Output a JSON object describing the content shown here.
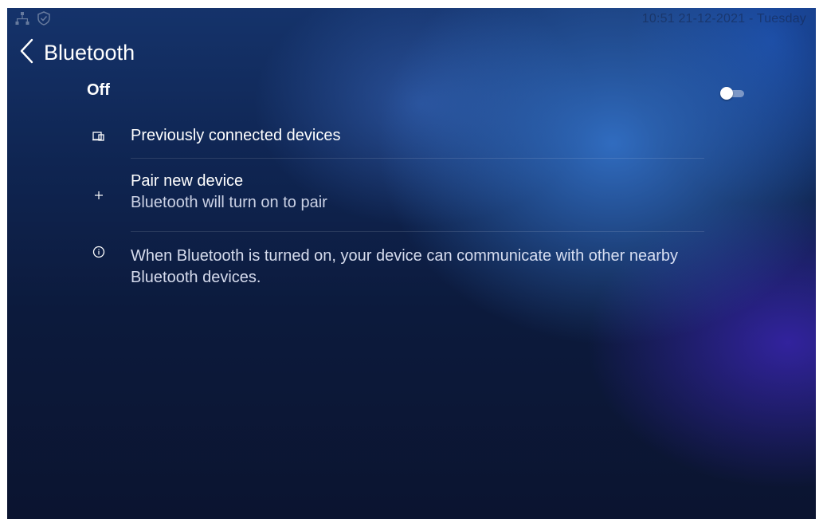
{
  "status_bar": {
    "icons": [
      "network-icon",
      "shield-check-icon"
    ],
    "clock": "10:51  21-12-2021 - Tuesday"
  },
  "header": {
    "back_icon": "chevron-left-icon",
    "title": "Bluetooth"
  },
  "bluetooth_toggle": {
    "label": "Off",
    "state": "off"
  },
  "items": {
    "previously_connected": {
      "icon": "devices-icon",
      "label": "Previously connected devices"
    },
    "pair_new": {
      "icon": "plus-icon",
      "label": "Pair new device",
      "subtitle": "Bluetooth will turn on to pair"
    }
  },
  "info": {
    "icon": "info-icon",
    "text": "When Bluetooth is turned on, your device can communicate with other nearby Bluetooth devices."
  }
}
